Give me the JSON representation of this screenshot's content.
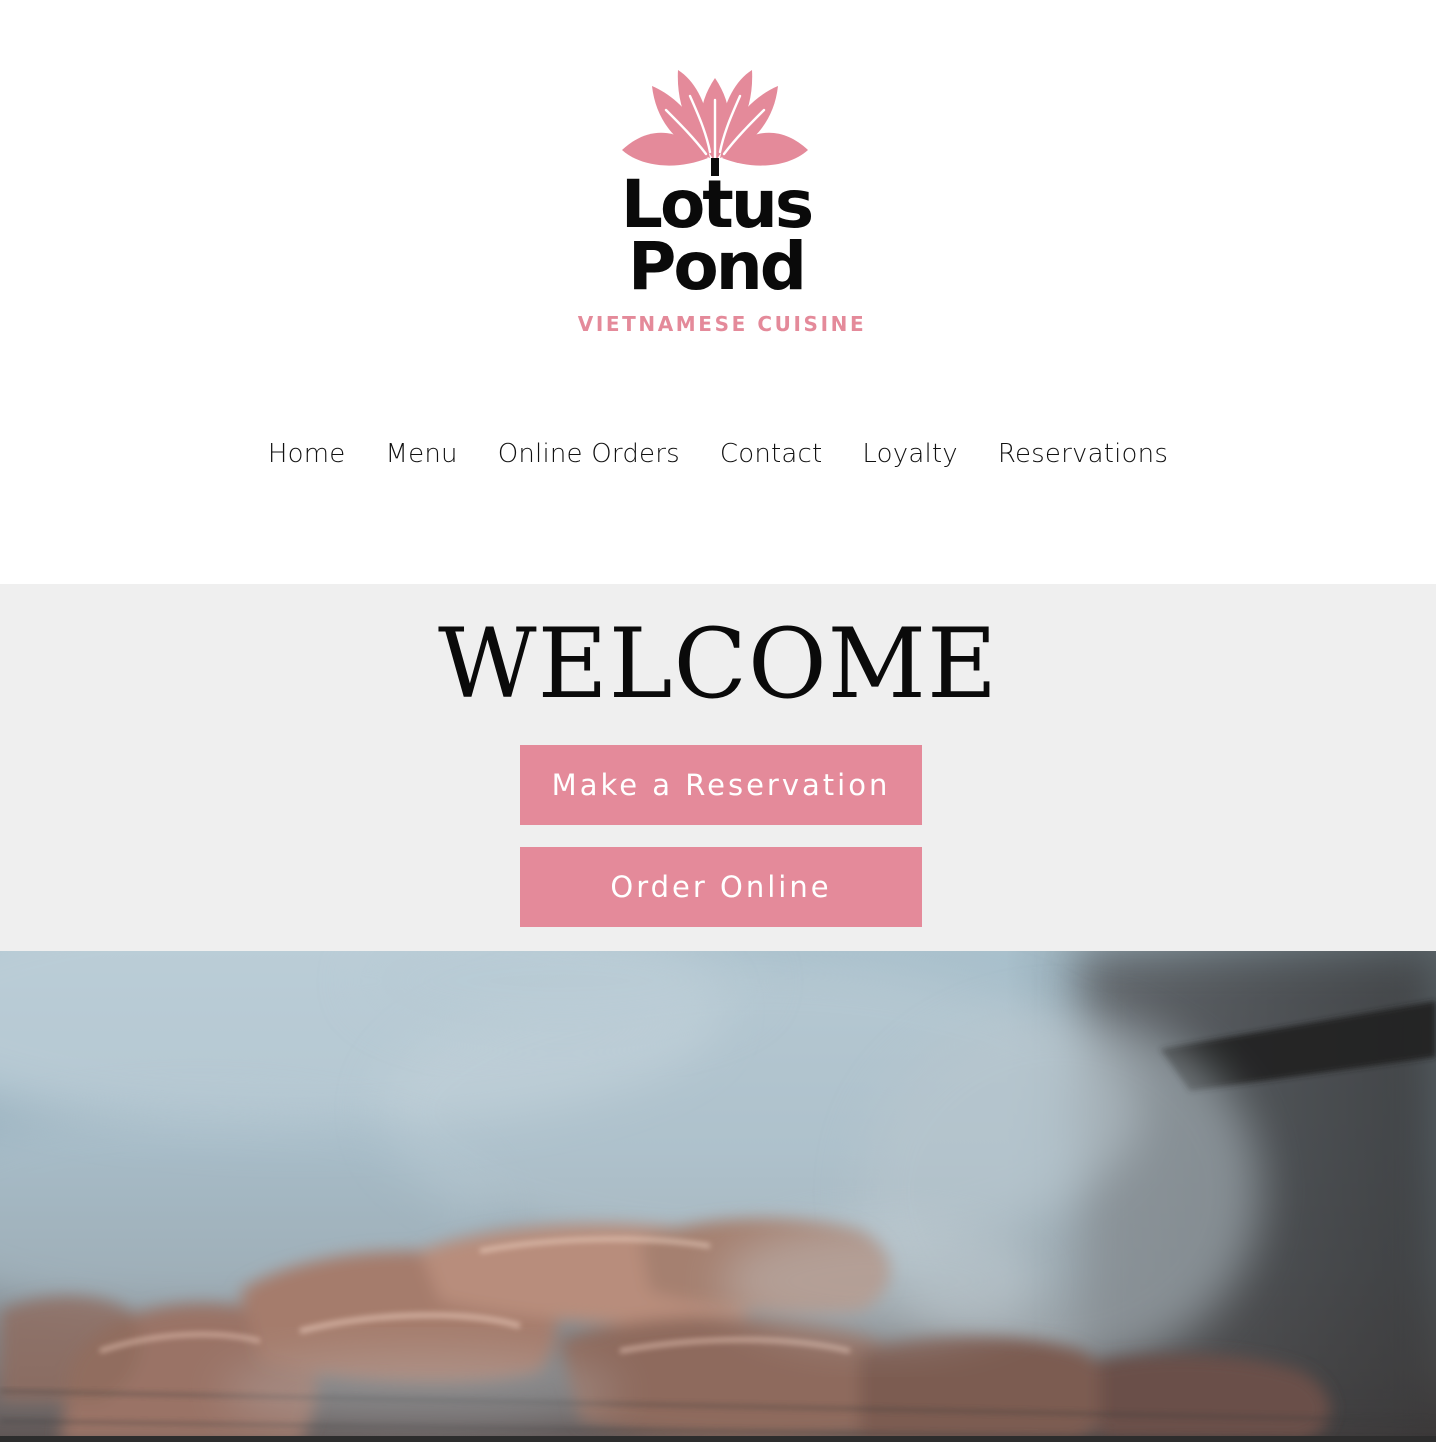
{
  "brand": {
    "name_line1": "Lotus",
    "name_line2": "Pond",
    "tagline": "VIETNAMESE CUISINE",
    "accent_color": "#e48a9a",
    "logo_icon": "lotus-flower-icon"
  },
  "nav": {
    "items": [
      {
        "label": "Home"
      },
      {
        "label": "Menu"
      },
      {
        "label": "Online Orders"
      },
      {
        "label": "Contact"
      },
      {
        "label": "Loyalty"
      },
      {
        "label": "Reservations"
      }
    ]
  },
  "welcome": {
    "title": "WELCOME",
    "background": "#efefef",
    "reserve_button": "Make a Reservation",
    "order_button": "Order Online"
  },
  "hero": {
    "image_subject": "smoky grill with meat"
  }
}
